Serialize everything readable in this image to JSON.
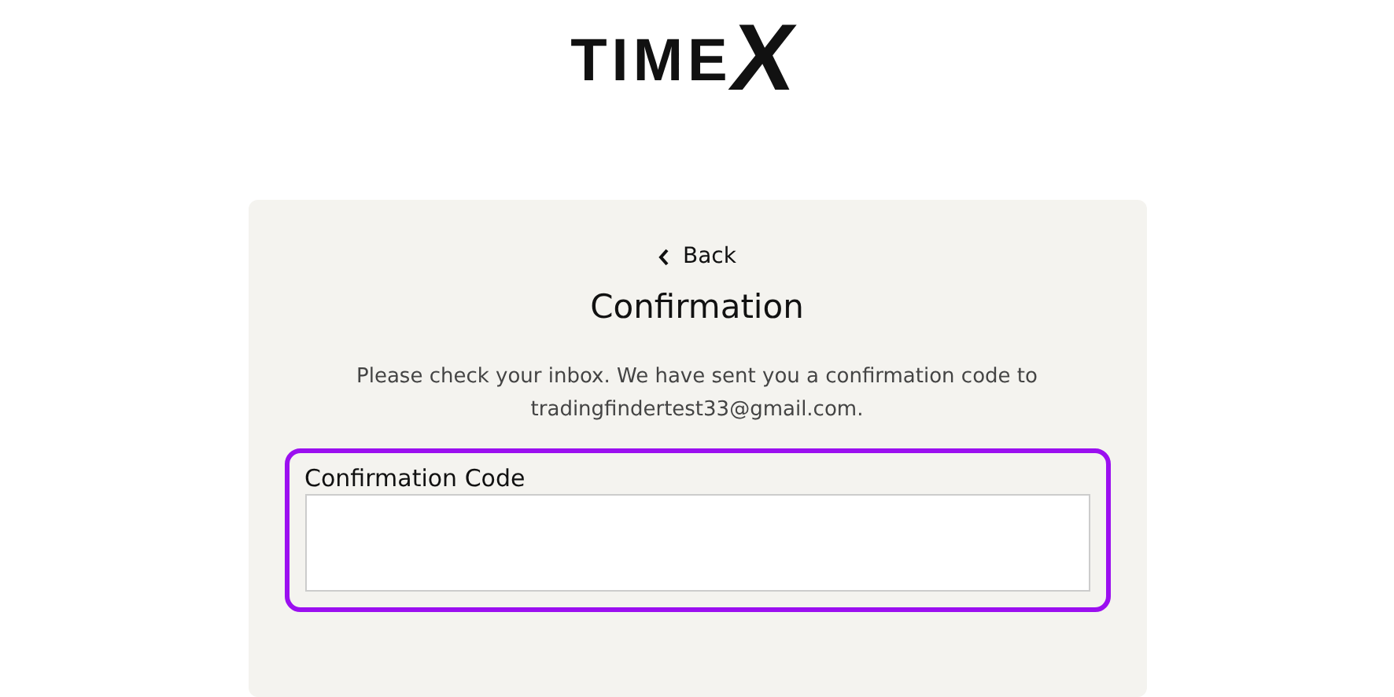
{
  "logo": {
    "text": "TIME",
    "mark": "X"
  },
  "card": {
    "back": "Back",
    "title": "Confirmation",
    "message": "Please check your inbox. We have sent you a confirmation code to tradingfindertest33@gmail.com.",
    "field": {
      "label": "Confirmation Code",
      "highlighted": true
    }
  }
}
